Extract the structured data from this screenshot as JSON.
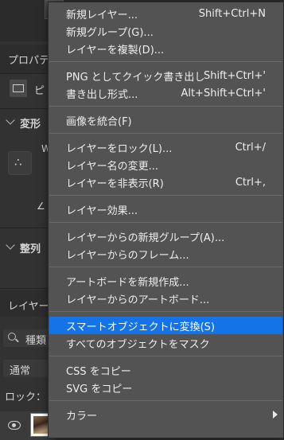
{
  "background": {
    "properties_tab": "プロパティ",
    "pixel_layer_label": "ピ",
    "transform_section": "変形",
    "w_label": "W",
    "angle_label": "∠",
    "align_section": "整列",
    "layers_tab": "レイヤー",
    "kind_filter": "種類",
    "blend_mode": "通常",
    "lock_label": "ロック："
  },
  "menu": {
    "groups": [
      [
        {
          "label": "新規レイヤー...",
          "shortcut": "Shift+Ctrl+N"
        },
        {
          "label": "新規グループ(G)..."
        },
        {
          "label": "レイヤーを複製(D)..."
        }
      ],
      [
        {
          "label": "PNG としてクイック書き出し",
          "shortcut": "Shift+Ctrl+'"
        },
        {
          "label": "書き出し形式...",
          "shortcut": "Alt+Shift+Ctrl+'"
        }
      ],
      [
        {
          "label": "画像を統合(F)"
        }
      ],
      [
        {
          "label": "レイヤーをロック(L)...",
          "shortcut": "Ctrl+/"
        },
        {
          "label": "レイヤー名の変更..."
        },
        {
          "label": "レイヤーを非表示(R)",
          "shortcut": "Ctrl+,"
        }
      ],
      [
        {
          "label": "レイヤー効果..."
        }
      ],
      [
        {
          "label": "レイヤーからの新規グループ(A)..."
        },
        {
          "label": "レイヤーからのフレーム..."
        }
      ],
      [
        {
          "label": "アートボードを新規作成..."
        },
        {
          "label": "レイヤーからのアートボード..."
        }
      ],
      [
        {
          "label": "スマートオブジェクトに変換(S)",
          "highlighted": true
        },
        {
          "label": "すべてのオブジェクトをマスク"
        }
      ],
      [
        {
          "label": "CSS をコピー"
        },
        {
          "label": "SVG をコピー"
        }
      ],
      [
        {
          "label": "カラー",
          "submenu": true
        }
      ]
    ]
  },
  "colors": {
    "menu_bg": "#535353",
    "highlight": "#1473e6",
    "separator": "#6b6b6b",
    "panel_bg": "#323232"
  }
}
